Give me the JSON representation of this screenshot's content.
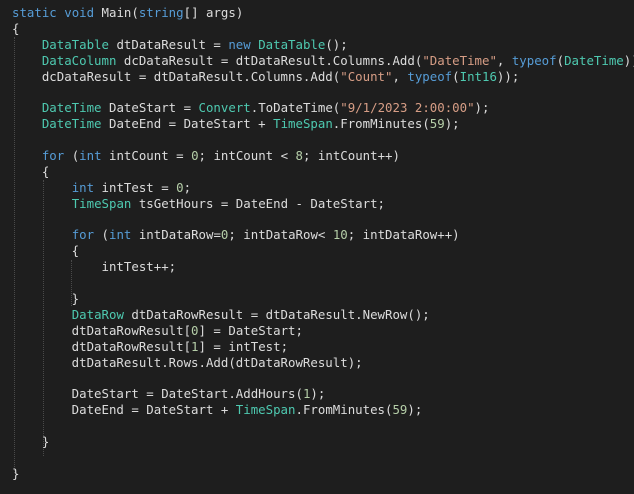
{
  "editor": {
    "theme_colors": {
      "background": "#1e1e1e",
      "keyword": "#569cd6",
      "type": "#4ec9b0",
      "string": "#d69d85",
      "number": "#b5cea8",
      "text": "#dcdcdc",
      "indent_guide": "#4a4a4a"
    },
    "lines": [
      [
        [
          "kw",
          "static"
        ],
        [
          "plain",
          " "
        ],
        [
          "kw",
          "void"
        ],
        [
          "plain",
          " Main("
        ],
        [
          "kw",
          "string"
        ],
        [
          "plain",
          "[] args)"
        ]
      ],
      [
        [
          "plain",
          "{"
        ]
      ],
      [
        [
          "plain",
          "    "
        ],
        [
          "type",
          "DataTable"
        ],
        [
          "plain",
          " dtDataResult = "
        ],
        [
          "kw",
          "new"
        ],
        [
          "plain",
          " "
        ],
        [
          "type",
          "DataTable"
        ],
        [
          "plain",
          "();"
        ]
      ],
      [
        [
          "plain",
          "    "
        ],
        [
          "type",
          "DataColumn"
        ],
        [
          "plain",
          " dcDataResult = dtDataResult.Columns.Add("
        ],
        [
          "str",
          "\"DateTime\""
        ],
        [
          "plain",
          ", "
        ],
        [
          "kw",
          "typeof"
        ],
        [
          "plain",
          "("
        ],
        [
          "type",
          "DateTime"
        ],
        [
          "plain",
          "));"
        ]
      ],
      [
        [
          "plain",
          "    dcDataResult = dtDataResult.Columns.Add("
        ],
        [
          "str",
          "\"Count\""
        ],
        [
          "plain",
          ", "
        ],
        [
          "kw",
          "typeof"
        ],
        [
          "plain",
          "("
        ],
        [
          "type",
          "Int16"
        ],
        [
          "plain",
          "));"
        ]
      ],
      [
        [
          "plain",
          ""
        ]
      ],
      [
        [
          "plain",
          "    "
        ],
        [
          "type",
          "DateTime"
        ],
        [
          "plain",
          " DateStart = "
        ],
        [
          "type",
          "Convert"
        ],
        [
          "plain",
          ".ToDateTime("
        ],
        [
          "str",
          "\"9/1/2023 2:00:00\""
        ],
        [
          "plain",
          ");"
        ]
      ],
      [
        [
          "plain",
          "    "
        ],
        [
          "type",
          "DateTime"
        ],
        [
          "plain",
          " DateEnd = DateStart + "
        ],
        [
          "type",
          "TimeSpan"
        ],
        [
          "plain",
          ".FromMinutes("
        ],
        [
          "num",
          "59"
        ],
        [
          "plain",
          ");"
        ]
      ],
      [
        [
          "plain",
          ""
        ]
      ],
      [
        [
          "plain",
          "    "
        ],
        [
          "kw",
          "for"
        ],
        [
          "plain",
          " ("
        ],
        [
          "kw",
          "int"
        ],
        [
          "plain",
          " intCount = "
        ],
        [
          "num",
          "0"
        ],
        [
          "plain",
          "; intCount < "
        ],
        [
          "num",
          "8"
        ],
        [
          "plain",
          "; intCount++)"
        ]
      ],
      [
        [
          "plain",
          "    {"
        ]
      ],
      [
        [
          "plain",
          "        "
        ],
        [
          "kw",
          "int"
        ],
        [
          "plain",
          " intTest = "
        ],
        [
          "num",
          "0"
        ],
        [
          "plain",
          ";"
        ]
      ],
      [
        [
          "plain",
          "        "
        ],
        [
          "type",
          "TimeSpan"
        ],
        [
          "plain",
          " tsGetHours = DateEnd - DateStart;"
        ]
      ],
      [
        [
          "plain",
          ""
        ]
      ],
      [
        [
          "plain",
          "        "
        ],
        [
          "kw",
          "for"
        ],
        [
          "plain",
          " ("
        ],
        [
          "kw",
          "int"
        ],
        [
          "plain",
          " intDataRow="
        ],
        [
          "num",
          "0"
        ],
        [
          "plain",
          "; intDataRow< "
        ],
        [
          "num",
          "10"
        ],
        [
          "plain",
          "; intDataRow++)"
        ]
      ],
      [
        [
          "plain",
          "        {"
        ]
      ],
      [
        [
          "plain",
          "            intTest++;"
        ]
      ],
      [
        [
          "plain",
          ""
        ]
      ],
      [
        [
          "plain",
          "        }"
        ]
      ],
      [
        [
          "plain",
          "        "
        ],
        [
          "type",
          "DataRow"
        ],
        [
          "plain",
          " dtDataRowResult = dtDataResult.NewRow();"
        ]
      ],
      [
        [
          "plain",
          "        dtDataRowResult["
        ],
        [
          "num",
          "0"
        ],
        [
          "plain",
          "] = DateStart;"
        ]
      ],
      [
        [
          "plain",
          "        dtDataRowResult["
        ],
        [
          "num",
          "1"
        ],
        [
          "plain",
          "] = intTest;"
        ]
      ],
      [
        [
          "plain",
          "        dtDataResult.Rows.Add(dtDataRowResult);"
        ]
      ],
      [
        [
          "plain",
          ""
        ]
      ],
      [
        [
          "plain",
          "        DateStart = DateStart.AddHours("
        ],
        [
          "num",
          "1"
        ],
        [
          "plain",
          ");"
        ]
      ],
      [
        [
          "plain",
          "        DateEnd = DateStart + "
        ],
        [
          "type",
          "TimeSpan"
        ],
        [
          "plain",
          ".FromMinutes("
        ],
        [
          "num",
          "59"
        ],
        [
          "plain",
          ");"
        ]
      ],
      [
        [
          "plain",
          ""
        ]
      ],
      [
        [
          "plain",
          "    }"
        ]
      ],
      [
        [
          "plain",
          ""
        ]
      ],
      [
        [
          "plain",
          "}"
        ]
      ]
    ]
  }
}
